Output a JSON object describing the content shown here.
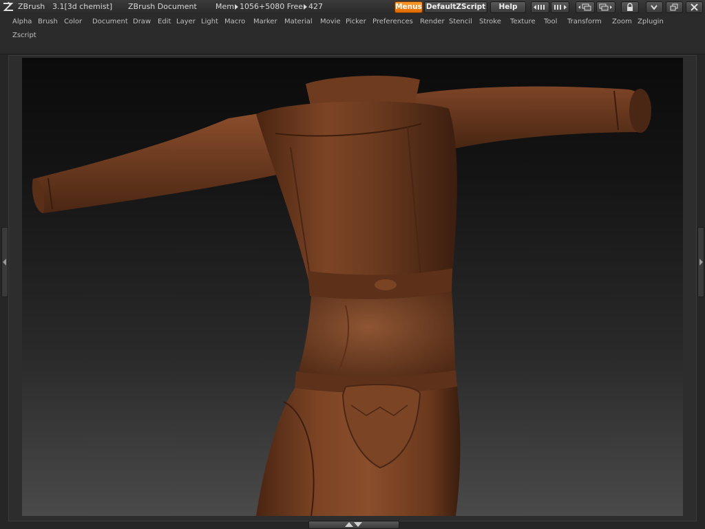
{
  "app": {
    "name": "ZBrush",
    "version": "3.1[3d chemist]",
    "document": "ZBrush Document",
    "mem_label": "Mem",
    "mem_value": "1056+5080",
    "free_label": "Free",
    "free_value": "427"
  },
  "toolbar": {
    "menus_label": "Menus",
    "script_label": "DefaultZScript",
    "help_label": "Help"
  },
  "menubar": {
    "items": [
      "Alpha",
      "Brush",
      "Color",
      "Document",
      "Draw",
      "Edit",
      "Layer",
      "Light",
      "Macro",
      "Marker",
      "Material",
      "Movie",
      "Picker",
      "Preferences",
      "Render",
      "Stencil",
      "Stroke",
      "Texture",
      "Tool",
      "Transform",
      "Zoom",
      "Zplugin",
      "Zscript"
    ]
  },
  "colors": {
    "accent": "#f07d10",
    "leather": "#6e3a1e",
    "background": "#262626"
  },
  "icons": {
    "logo": "zbrush-logo-icon",
    "lock": "lock-icon",
    "minimize": "minimize-icon",
    "restore": "restore-icon",
    "close": "close-icon"
  }
}
